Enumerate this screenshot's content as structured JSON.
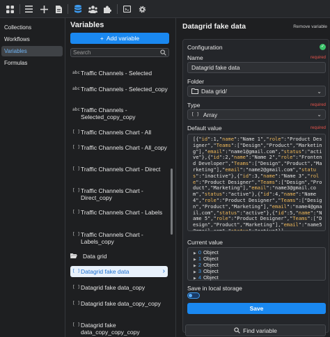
{
  "toolbar": {
    "icons": [
      "grid-icon",
      "list-icon",
      "plus-icon",
      "document-icon",
      "database-icon",
      "users-icon",
      "puzzle-icon",
      "code-icon",
      "gear-icon"
    ],
    "active_icon": "database-icon"
  },
  "nav": {
    "items": [
      {
        "label": "Collections"
      },
      {
        "label": "Workflows"
      },
      {
        "label": "Variables",
        "active": true
      },
      {
        "label": "Formulas"
      }
    ]
  },
  "variables": {
    "title": "Variables",
    "add_label": "Add variable",
    "search_placeholder": "Search",
    "items": [
      {
        "icon": "abc",
        "label": "Traffic Channels - Selected"
      },
      {
        "icon": "abc",
        "label": "Traffic Channels - Selected_copy"
      },
      {
        "icon": "abc",
        "label": "Traffic Channels - Selected_copy_copy"
      },
      {
        "icon": "[ ]",
        "label": "Traffic Channels Chart - All"
      },
      {
        "icon": "[ ]",
        "label": "Traffic Channels Chart - All_copy"
      },
      {
        "icon": "[ ]",
        "label": "Traffic Channels Chart - Direct"
      },
      {
        "icon": "[ ]",
        "label": "Traffic Channels Chart - Direct_copy"
      },
      {
        "icon": "[ ]",
        "label": "Traffic Channels Chart - Labels"
      },
      {
        "icon": "[ ]",
        "label": "Traffic Channels Chart - Labels_copy"
      },
      {
        "icon": "folder",
        "label": "Data grid"
      },
      {
        "icon": "[ ]",
        "label": "Datagrid fake data",
        "selected": true
      },
      {
        "icon": "[ ]",
        "label": "Datagrid fake data_copy"
      },
      {
        "icon": "[ ]",
        "label": "Datagrid fake data_copy_copy"
      },
      {
        "icon": "[ ]",
        "label": "Datagrid fake data_copy_copy_copy"
      }
    ]
  },
  "detail": {
    "title": "Datagrid fake data",
    "remove_label": "Remove variable",
    "configuration_label": "Configuration",
    "required_label": "required",
    "name_label": "Name",
    "name_value": "Datagrid fake data",
    "folder_label": "Folder",
    "folder_value": "Data grid/",
    "type_label": "Type",
    "type_value": "Array",
    "default_label": "Default value",
    "default_value": "[{\"id\":1,\"name\":\"Name 1\",\"role\":\"Product Designer\",\"Teams\":[\"Design\",\"Product\",\"Marketing\"],\"email\":\"name1@gmail.com\",\"status\":\"active\"},{\"id\":2,\"name\":\"Name 2\",\"role\":\"Frontend Developer\",\"Teams\":[\"Design\",\"Product\",\"Marketing\"],\"email\":\"name2@gmail.com\",\"status\":\"inactive\"},{\"id\":3,\"name\":\"Name 3\",\"role\":\"Product Designer\",\"Teams\":[\"Design\",\"Product\",\"Marketing\"],\"email\":\"name3@gmail.com\",\"status\":\"active\"},{\"id\":4,\"name\":\"Name 4\",\"role\":\"Product Designer\",\"Teams\":[\"Design\",\"Product\",\"Marketing\"],\"email\":\"name4@gmail.com\",\"status\":\"active\"},{\"id\":5,\"name\":\"Name 5\",\"role\":\"Product Designer\",\"Teams\":[\"Design\",\"Product\",\"Marketing\"],\"email\":\"name5@gmail.com\",\"status\":\"active\"}]",
    "current_label": "Current value",
    "current_items": [
      {
        "index": "0",
        "type": "Object"
      },
      {
        "index": "1",
        "type": "Object"
      },
      {
        "index": "2",
        "type": "Object"
      },
      {
        "index": "3",
        "type": "Object"
      },
      {
        "index": "4",
        "type": "Object"
      }
    ],
    "local_storage_label": "Save in local storage",
    "local_storage_on": true,
    "save_label": "Save",
    "find_label": "Find variable"
  },
  "colors": {
    "accent": "#1a88f0",
    "required": "#e5534b",
    "success": "#3cc36b"
  }
}
